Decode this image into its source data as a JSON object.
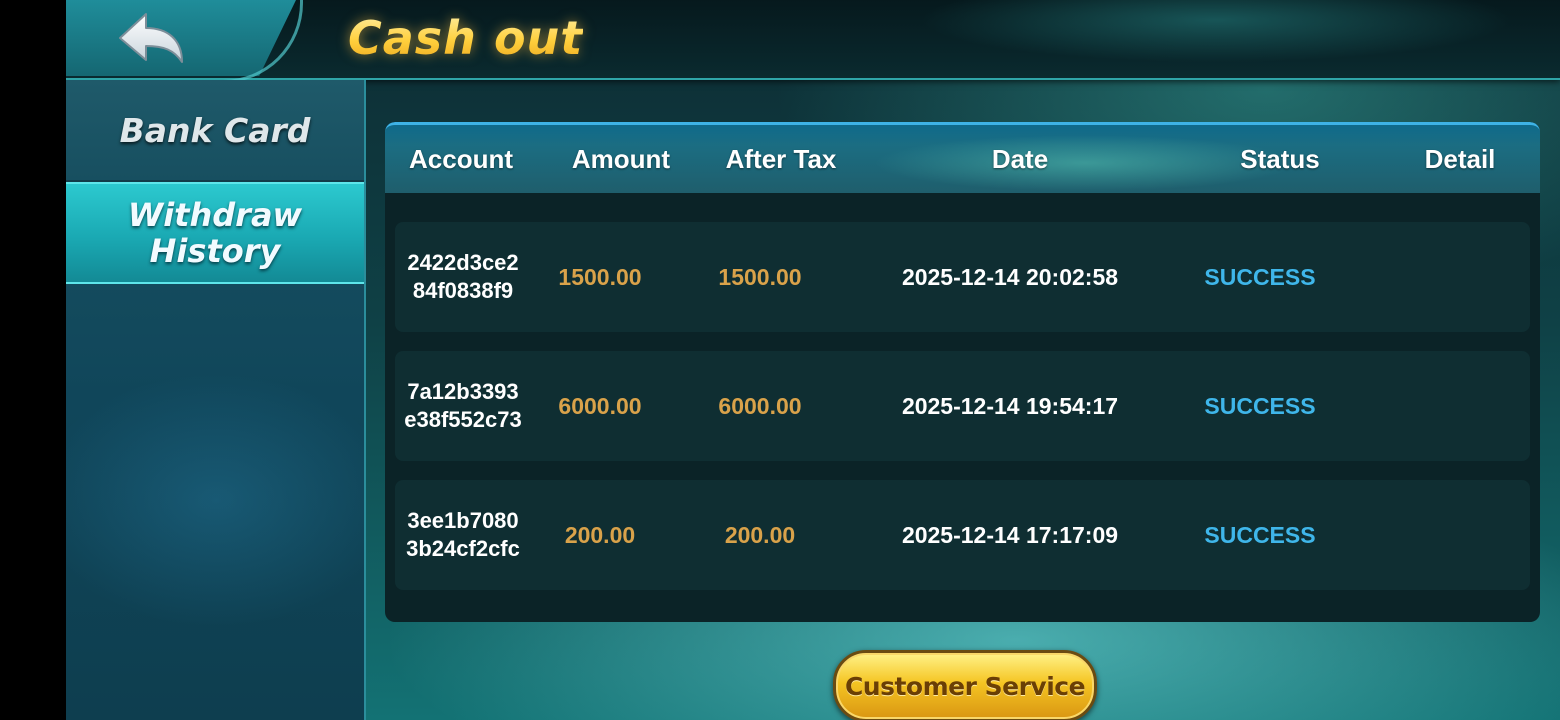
{
  "header": {
    "title": "Cash out",
    "back_icon": "back-arrow-icon"
  },
  "sidebar": {
    "items": [
      {
        "label": "Bank Card",
        "active": false
      },
      {
        "label": "Withdraw\nHistory",
        "active": true
      }
    ]
  },
  "table": {
    "columns": [
      "Account",
      "Amount",
      "After Tax",
      "Date",
      "Status",
      "Detail"
    ],
    "rows": [
      {
        "account": "2422d3ce284f0838f9",
        "amount": "1500.00",
        "after_tax": "1500.00",
        "date": "2025-12-14 20:02:58",
        "status": "SUCCESS",
        "detail": ""
      },
      {
        "account": "7a12b3393e38f552c73",
        "amount": "6000.00",
        "after_tax": "6000.00",
        "date": "2025-12-14 19:54:17",
        "status": "SUCCESS",
        "detail": ""
      },
      {
        "account": "3ee1b70803b24cf2cfc",
        "amount": "200.00",
        "after_tax": "200.00",
        "date": "2025-12-14 17:17:09",
        "status": "SUCCESS",
        "detail": ""
      }
    ]
  },
  "footer": {
    "customer_service_label": "Customer Service"
  },
  "colors": {
    "title_gold": "#ffd65a",
    "amount_gold": "#d9a24a",
    "status_blue": "#3fb6ea",
    "accent_teal": "#2cc9cf"
  }
}
